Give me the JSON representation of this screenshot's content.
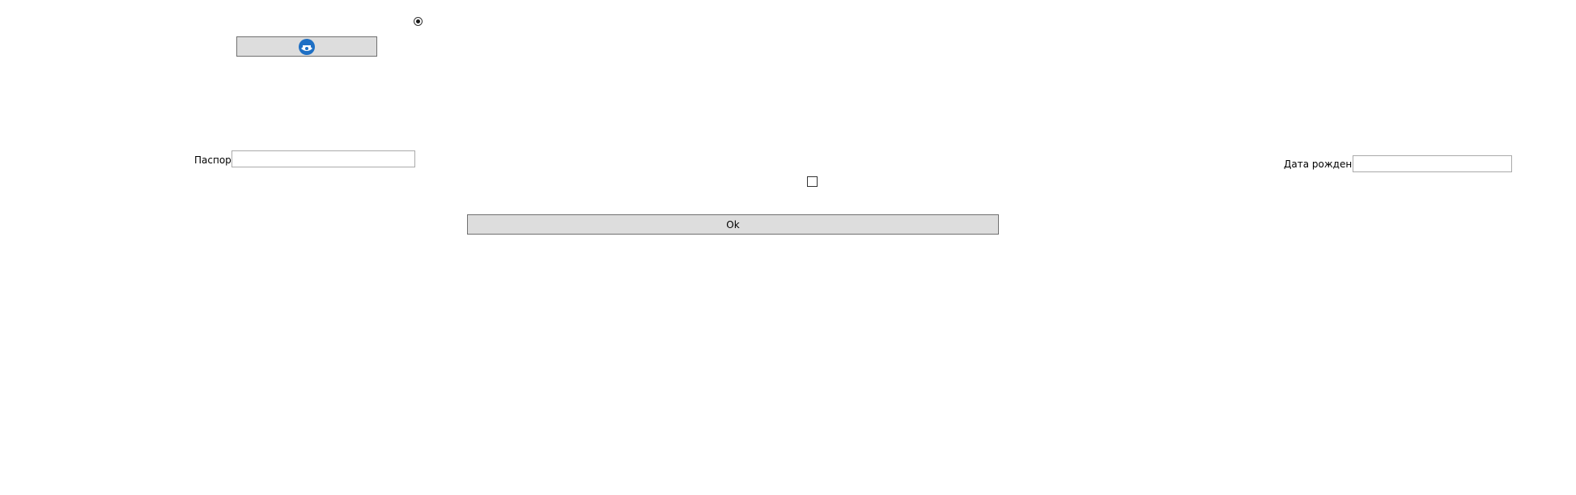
{
  "radio": {
    "checked": true
  },
  "icon_button": {
    "icon": "logo-icon"
  },
  "passport": {
    "label": "Паспорт",
    "value": "",
    "placeholder": ""
  },
  "birthdate": {
    "label": "Дата рождения",
    "value": "",
    "placeholder": ""
  },
  "checkbox": {
    "checked": false
  },
  "ok_button": {
    "label": "Ok"
  },
  "colors": {
    "button_bg": "#dddddd",
    "button_border": "#707070",
    "input_border": "#aaaaaa",
    "logo_blue": "#1e6fc4"
  }
}
